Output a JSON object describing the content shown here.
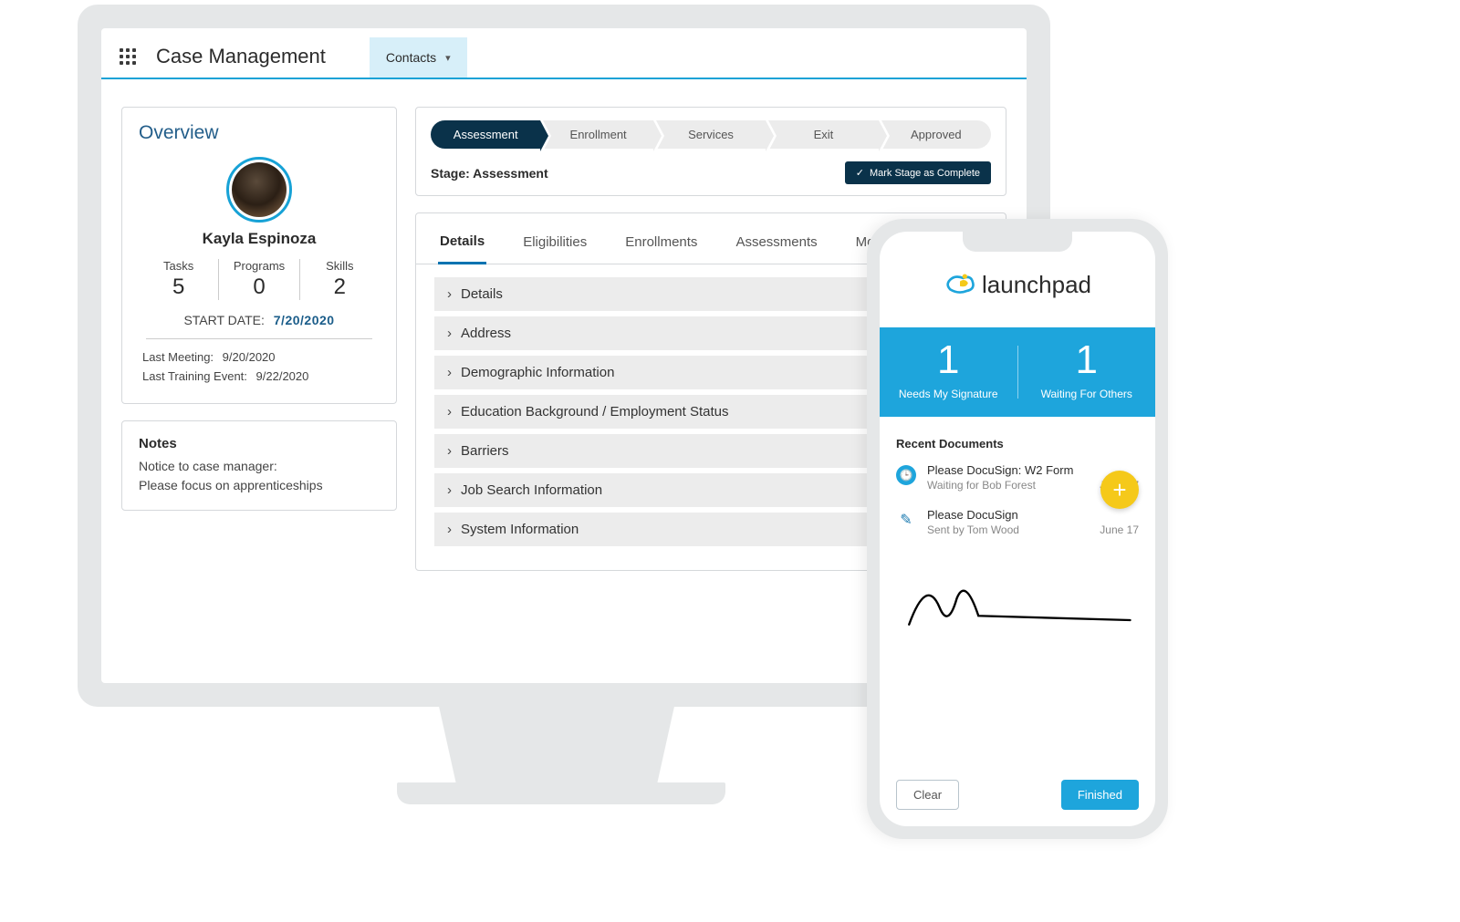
{
  "header": {
    "app_title": "Case Management",
    "nav_tab": "Contacts"
  },
  "overview": {
    "title": "Overview",
    "name": "Kayla Espinoza",
    "stats": [
      {
        "label": "Tasks",
        "value": "5"
      },
      {
        "label": "Programs",
        "value": "0"
      },
      {
        "label": "Skills",
        "value": "2"
      }
    ],
    "start_date_label": "START DATE:",
    "start_date_value": "7/20/2020",
    "last_meeting_label": "Last Meeting:",
    "last_meeting_value": "9/20/2020",
    "last_training_label": "Last Training Event:",
    "last_training_value": "9/22/2020"
  },
  "notes": {
    "title": "Notes",
    "line1": "Notice to case manager:",
    "line2": "Please focus on apprenticeships"
  },
  "path": {
    "steps": [
      "Assessment",
      "Enrollment",
      "Services",
      "Exit",
      "Approved"
    ],
    "stage_label": "Stage: Assessment",
    "mark_complete": "Mark Stage as Complete"
  },
  "tabs": {
    "items": [
      "Details",
      "Eligibilities",
      "Enrollments",
      "Assessments"
    ],
    "more": "More"
  },
  "accordion": [
    "Details",
    "Address",
    "Demographic Information",
    "Education Background / Employment Status",
    "Barriers",
    "Job Search Information",
    "System Information"
  ],
  "phone": {
    "logo_text": "launchpad",
    "band": [
      {
        "num": "1",
        "label": "Needs My Signature"
      },
      {
        "num": "1",
        "label": "Waiting For Others"
      }
    ],
    "recent_title": "Recent Documents",
    "docs": [
      {
        "title": "Please DocuSign: W2 Form",
        "sub": "Waiting for Bob Forest",
        "date": "June 17"
      },
      {
        "title": "Please DocuSign",
        "sub": "Sent by Tom Wood",
        "date": "June 17"
      }
    ],
    "clear": "Clear",
    "finished": "Finished"
  }
}
